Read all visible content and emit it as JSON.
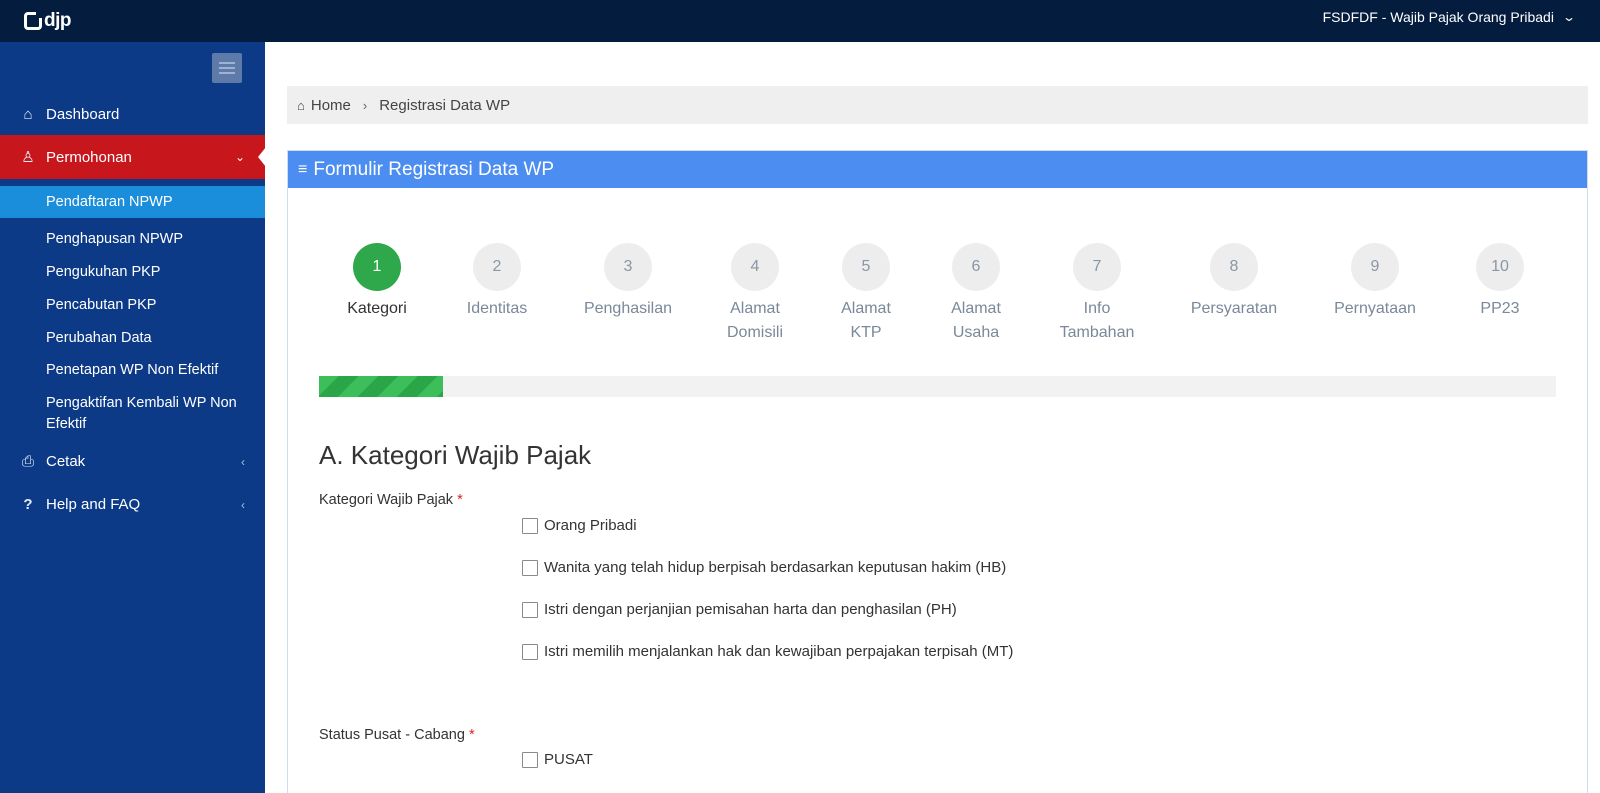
{
  "header": {
    "logo_text": "djp",
    "user_label": "FSDFDF - Wajib Pajak Orang Pribadi"
  },
  "sidebar": {
    "items": [
      {
        "label": "Dashboard",
        "icon": "home-icon"
      },
      {
        "label": "Permohonan",
        "icon": "user-medical-icon",
        "active": true
      },
      {
        "label": "Cetak",
        "icon": "printer-icon"
      },
      {
        "label": "Help and FAQ",
        "icon": "question-icon"
      }
    ],
    "submenu": [
      {
        "label": "Pendaftaran NPWP",
        "active": true
      },
      {
        "label": "Penghapusan NPWP"
      },
      {
        "label": "Pengukuhan PKP"
      },
      {
        "label": "Pencabutan PKP"
      },
      {
        "label": "Perubahan Data"
      },
      {
        "label": "Penetapan WP Non Efektif"
      },
      {
        "label": "Pengaktifan Kembali WP Non Efektif"
      }
    ]
  },
  "breadcrumb": {
    "home": "Home",
    "current": "Registrasi Data WP"
  },
  "panel": {
    "title": "Formulir Registrasi Data WP"
  },
  "steps": [
    {
      "num": "1",
      "line1": "Kategori",
      "line2": ""
    },
    {
      "num": "2",
      "line1": "Identitas",
      "line2": ""
    },
    {
      "num": "3",
      "line1": "Penghasilan",
      "line2": ""
    },
    {
      "num": "4",
      "line1": "Alamat",
      "line2": "Domisili"
    },
    {
      "num": "5",
      "line1": "Alamat",
      "line2": "KTP"
    },
    {
      "num": "6",
      "line1": "Alamat",
      "line2": "Usaha"
    },
    {
      "num": "7",
      "line1": "Info",
      "line2": "Tambahan"
    },
    {
      "num": "8",
      "line1": "Persyaratan",
      "line2": ""
    },
    {
      "num": "9",
      "line1": "Pernyataan",
      "line2": ""
    },
    {
      "num": "10",
      "line1": "PP23",
      "line2": ""
    }
  ],
  "progress": {
    "fraction": 0.1
  },
  "form": {
    "section_title": "A. Kategori Wajib Pajak",
    "kategori_label": "Kategori Wajib Pajak",
    "required_mark": "*",
    "kategori_options": [
      "Orang Pribadi",
      "Wanita yang telah hidup berpisah berdasarkan keputusan hakim (HB)",
      "Istri dengan perjanjian pemisahan harta dan penghasilan (PH)",
      "Istri memilih menjalankan hak dan kewajiban perpajakan terpisah (MT)"
    ],
    "status_label": "Status Pusat - Cabang",
    "status_options": [
      "PUSAT"
    ]
  }
}
